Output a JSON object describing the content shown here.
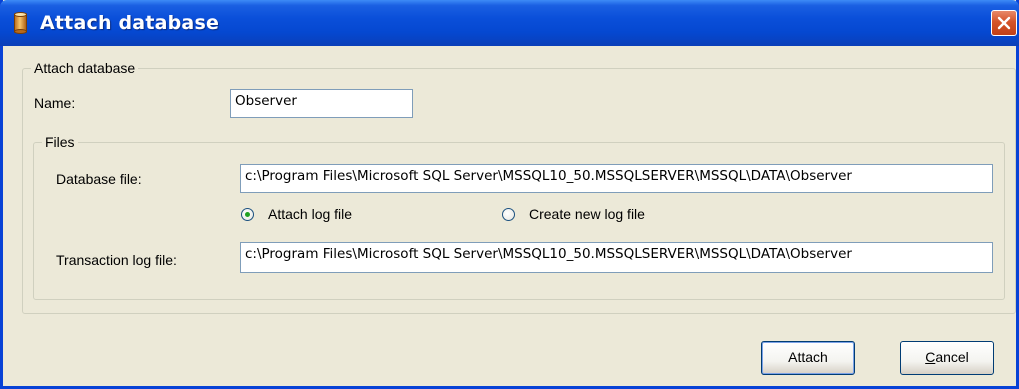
{
  "window": {
    "title": "Attach database",
    "close_label": "×"
  },
  "attach_group": {
    "legend": "Attach database",
    "name_label": "Name:",
    "name_value": "Observer"
  },
  "files_group": {
    "legend": "Files",
    "database_file_label": "Database file:",
    "database_file_value": "c:\\Program Files\\Microsoft SQL Server\\MSSQL10_50.MSSQLSERVER\\MSSQL\\DATA\\Observer",
    "attach_log_label": "Attach log file",
    "attach_log_selected": true,
    "create_log_label": "Create new log file",
    "create_log_selected": false,
    "transaction_log_label": "Transaction log file:",
    "transaction_log_value": "c:\\Program Files\\Microsoft SQL Server\\MSSQL10_50.MSSQLSERVER\\MSSQL\\DATA\\Observer"
  },
  "buttons": {
    "attach_label": "Attach",
    "cancel_label": "Cancel"
  },
  "colors": {
    "titlebar": "#0548d1",
    "dialog_background": "#ece9d8",
    "close_button": "#d4542a",
    "radio_dot": "#21a121"
  },
  "icons": {
    "app": "database-cylinder-icon",
    "close": "close-icon"
  }
}
